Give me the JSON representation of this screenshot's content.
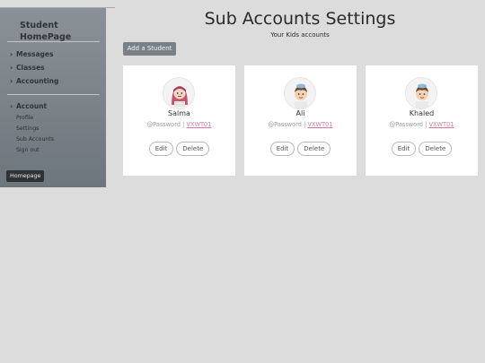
{
  "sidebar": {
    "brand": "Student HomePage",
    "nav": [
      {
        "label": "Messages"
      },
      {
        "label": "Classes"
      },
      {
        "label": "Accounting"
      }
    ],
    "account": {
      "label": "Account",
      "items": [
        "Profile",
        "Settings",
        "Sub Accounts",
        "Sign out"
      ]
    },
    "homepage_button": "Homepage"
  },
  "main": {
    "title": "Sub Accounts Settings",
    "subtitle": "Your Kids accounts",
    "add_button": "Add a Student",
    "students": [
      {
        "name": "Salma",
        "password_label": "@Password",
        "separator": "|",
        "code": "VXWT01",
        "edit": "Edit",
        "delete": "Delete",
        "avatar": "girl-hijab-icon"
      },
      {
        "name": "Ali",
        "password_label": "@Password",
        "separator": "|",
        "code": "VXWT01",
        "edit": "Edit",
        "delete": "Delete",
        "avatar": "boy-cap-icon"
      },
      {
        "name": "Khaled",
        "password_label": "@Password",
        "separator": "|",
        "code": "VXWT01",
        "edit": "Edit",
        "delete": "Delete",
        "avatar": "boy-cap-icon"
      }
    ]
  },
  "colors": {
    "sidebar_top": "#8a9197",
    "sidebar_bottom": "#6e767d",
    "code_link": "#d4789b",
    "add_button": "#7a8186"
  }
}
